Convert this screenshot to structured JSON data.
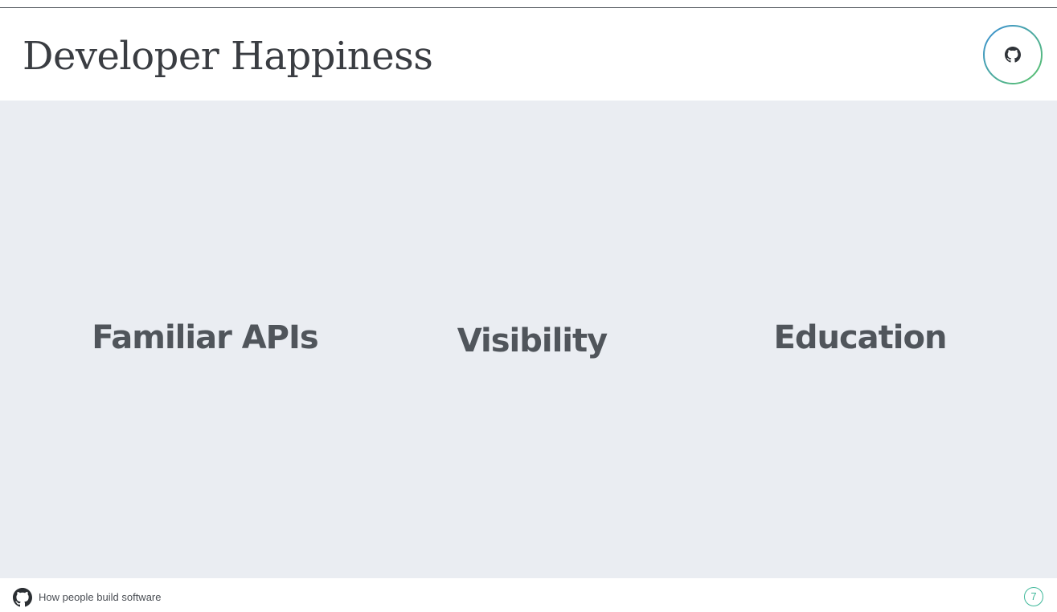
{
  "slide": {
    "title": "Developer Happiness",
    "badge_icon": "github-octocat-icon",
    "pillars": [
      {
        "label": "Familiar APIs"
      },
      {
        "label": "Visibility"
      },
      {
        "label": "Education"
      }
    ]
  },
  "footer": {
    "logo_icon": "github-octocat-icon",
    "tagline": "How people build software",
    "page_number": "7"
  },
  "colors": {
    "content_background": "#eaedf2",
    "pillar_text": "#50555b",
    "title_text": "#3a3d42",
    "badge_gradient_start": "#3b8fd6",
    "badge_gradient_end": "#5cc46a",
    "page_number_accent": "#3fb89a"
  }
}
